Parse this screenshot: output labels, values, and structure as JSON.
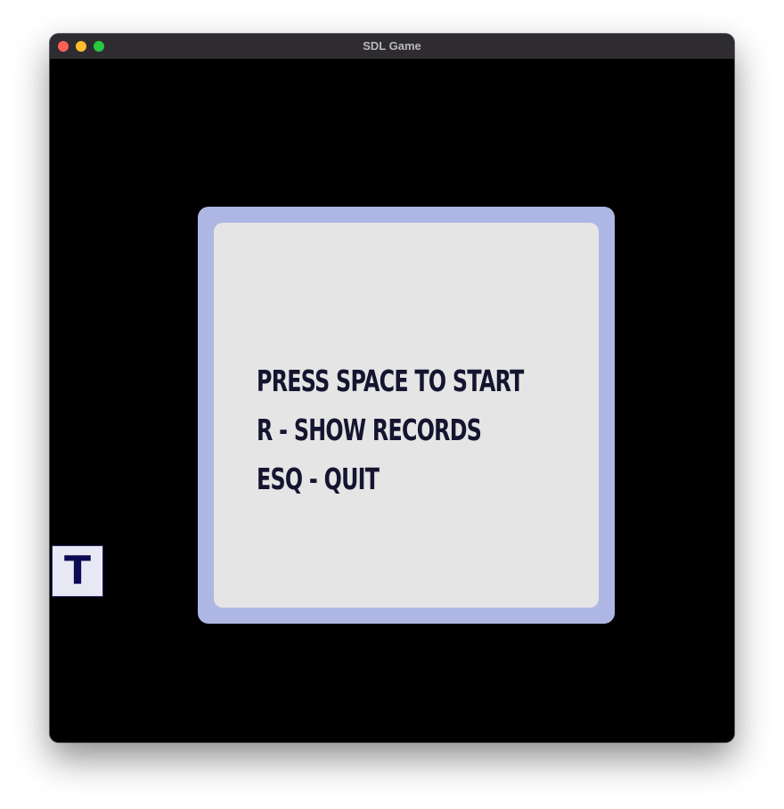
{
  "window": {
    "title": "SDL Game"
  },
  "menu": {
    "lines": [
      "PRESS SPACE TO START",
      "R - SHOW RECORDS",
      "ESQ - QUIT"
    ]
  },
  "badge": {
    "letter": "T"
  },
  "colors": {
    "background": "#000000",
    "frame": "#aeb7e4",
    "panel": "#e5e5e5",
    "text": "#151530",
    "badge_text": "#0c0a52"
  }
}
